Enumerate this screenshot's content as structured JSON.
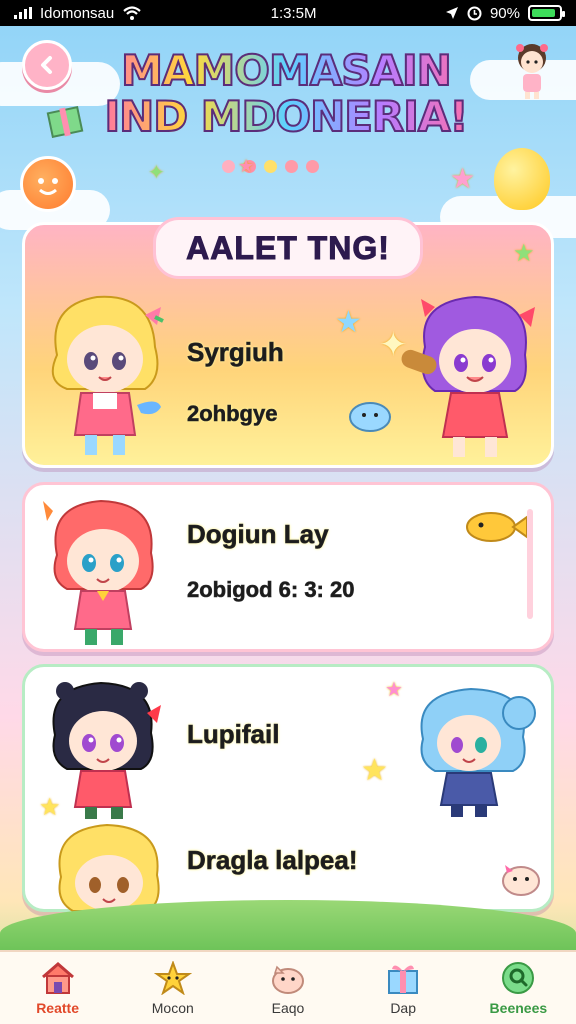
{
  "status_bar": {
    "carrier": "Idomonsau",
    "time": "1:3:5M",
    "battery": "90%",
    "battery_level": 0.9
  },
  "header": {
    "title_line1": "MAMOMASAIN",
    "title_line2": "IND MDONERIA!"
  },
  "pager_dots": [
    "#ffb0c0",
    "#ff8fa8",
    "#ffe06a",
    "#ff9aa8",
    "#ff9aa8"
  ],
  "cards": [
    {
      "banner": "AALET TNG!",
      "line1": "Syrgiuh",
      "line2": "2ohbgye"
    },
    {
      "line1": "Dogiun Lay",
      "line2": "2obigod 6: 3: 20"
    },
    {
      "line1": "Lupifail",
      "line2": "Dragla lalpea!"
    }
  ],
  "bottom_nav": [
    {
      "label": "Reatte",
      "icon": "house-icon"
    },
    {
      "label": "Mocon",
      "icon": "star-creature-icon"
    },
    {
      "label": "Eaqo",
      "icon": "pet-icon"
    },
    {
      "label": "Dap",
      "icon": "gift-box-icon"
    },
    {
      "label": "Beenees",
      "icon": "search-icon"
    }
  ],
  "colors": {
    "accent_pink": "#ff6fa8",
    "card_gold": "#ffd47a",
    "active_nav": "#e2492a",
    "green_nav": "#3a9a45"
  }
}
